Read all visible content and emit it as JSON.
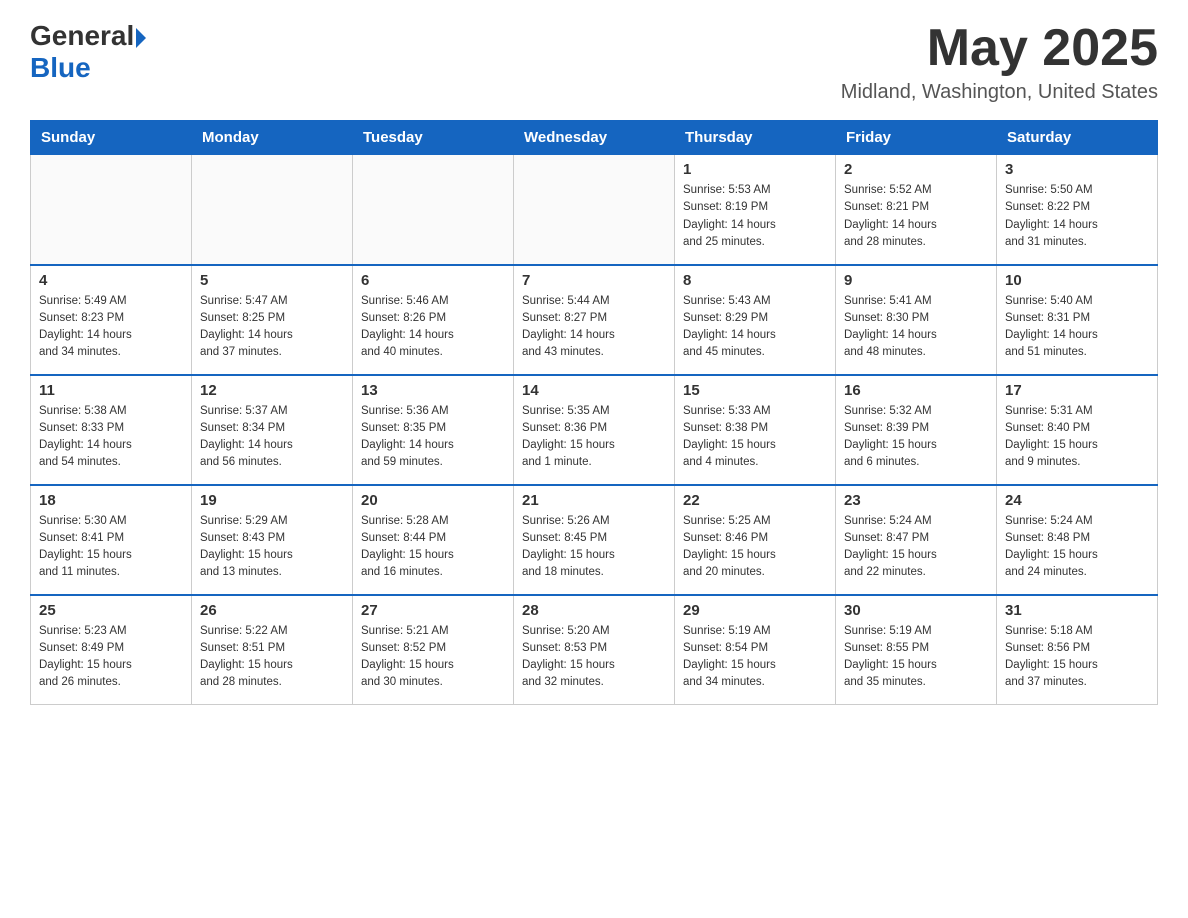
{
  "header": {
    "logo_general": "General",
    "logo_blue": "Blue",
    "month_title": "May 2025",
    "location": "Midland, Washington, United States"
  },
  "weekdays": [
    "Sunday",
    "Monday",
    "Tuesday",
    "Wednesday",
    "Thursday",
    "Friday",
    "Saturday"
  ],
  "weeks": [
    [
      {
        "day": "",
        "info": ""
      },
      {
        "day": "",
        "info": ""
      },
      {
        "day": "",
        "info": ""
      },
      {
        "day": "",
        "info": ""
      },
      {
        "day": "1",
        "info": "Sunrise: 5:53 AM\nSunset: 8:19 PM\nDaylight: 14 hours\nand 25 minutes."
      },
      {
        "day": "2",
        "info": "Sunrise: 5:52 AM\nSunset: 8:21 PM\nDaylight: 14 hours\nand 28 minutes."
      },
      {
        "day": "3",
        "info": "Sunrise: 5:50 AM\nSunset: 8:22 PM\nDaylight: 14 hours\nand 31 minutes."
      }
    ],
    [
      {
        "day": "4",
        "info": "Sunrise: 5:49 AM\nSunset: 8:23 PM\nDaylight: 14 hours\nand 34 minutes."
      },
      {
        "day": "5",
        "info": "Sunrise: 5:47 AM\nSunset: 8:25 PM\nDaylight: 14 hours\nand 37 minutes."
      },
      {
        "day": "6",
        "info": "Sunrise: 5:46 AM\nSunset: 8:26 PM\nDaylight: 14 hours\nand 40 minutes."
      },
      {
        "day": "7",
        "info": "Sunrise: 5:44 AM\nSunset: 8:27 PM\nDaylight: 14 hours\nand 43 minutes."
      },
      {
        "day": "8",
        "info": "Sunrise: 5:43 AM\nSunset: 8:29 PM\nDaylight: 14 hours\nand 45 minutes."
      },
      {
        "day": "9",
        "info": "Sunrise: 5:41 AM\nSunset: 8:30 PM\nDaylight: 14 hours\nand 48 minutes."
      },
      {
        "day": "10",
        "info": "Sunrise: 5:40 AM\nSunset: 8:31 PM\nDaylight: 14 hours\nand 51 minutes."
      }
    ],
    [
      {
        "day": "11",
        "info": "Sunrise: 5:38 AM\nSunset: 8:33 PM\nDaylight: 14 hours\nand 54 minutes."
      },
      {
        "day": "12",
        "info": "Sunrise: 5:37 AM\nSunset: 8:34 PM\nDaylight: 14 hours\nand 56 minutes."
      },
      {
        "day": "13",
        "info": "Sunrise: 5:36 AM\nSunset: 8:35 PM\nDaylight: 14 hours\nand 59 minutes."
      },
      {
        "day": "14",
        "info": "Sunrise: 5:35 AM\nSunset: 8:36 PM\nDaylight: 15 hours\nand 1 minute."
      },
      {
        "day": "15",
        "info": "Sunrise: 5:33 AM\nSunset: 8:38 PM\nDaylight: 15 hours\nand 4 minutes."
      },
      {
        "day": "16",
        "info": "Sunrise: 5:32 AM\nSunset: 8:39 PM\nDaylight: 15 hours\nand 6 minutes."
      },
      {
        "day": "17",
        "info": "Sunrise: 5:31 AM\nSunset: 8:40 PM\nDaylight: 15 hours\nand 9 minutes."
      }
    ],
    [
      {
        "day": "18",
        "info": "Sunrise: 5:30 AM\nSunset: 8:41 PM\nDaylight: 15 hours\nand 11 minutes."
      },
      {
        "day": "19",
        "info": "Sunrise: 5:29 AM\nSunset: 8:43 PM\nDaylight: 15 hours\nand 13 minutes."
      },
      {
        "day": "20",
        "info": "Sunrise: 5:28 AM\nSunset: 8:44 PM\nDaylight: 15 hours\nand 16 minutes."
      },
      {
        "day": "21",
        "info": "Sunrise: 5:26 AM\nSunset: 8:45 PM\nDaylight: 15 hours\nand 18 minutes."
      },
      {
        "day": "22",
        "info": "Sunrise: 5:25 AM\nSunset: 8:46 PM\nDaylight: 15 hours\nand 20 minutes."
      },
      {
        "day": "23",
        "info": "Sunrise: 5:24 AM\nSunset: 8:47 PM\nDaylight: 15 hours\nand 22 minutes."
      },
      {
        "day": "24",
        "info": "Sunrise: 5:24 AM\nSunset: 8:48 PM\nDaylight: 15 hours\nand 24 minutes."
      }
    ],
    [
      {
        "day": "25",
        "info": "Sunrise: 5:23 AM\nSunset: 8:49 PM\nDaylight: 15 hours\nand 26 minutes."
      },
      {
        "day": "26",
        "info": "Sunrise: 5:22 AM\nSunset: 8:51 PM\nDaylight: 15 hours\nand 28 minutes."
      },
      {
        "day": "27",
        "info": "Sunrise: 5:21 AM\nSunset: 8:52 PM\nDaylight: 15 hours\nand 30 minutes."
      },
      {
        "day": "28",
        "info": "Sunrise: 5:20 AM\nSunset: 8:53 PM\nDaylight: 15 hours\nand 32 minutes."
      },
      {
        "day": "29",
        "info": "Sunrise: 5:19 AM\nSunset: 8:54 PM\nDaylight: 15 hours\nand 34 minutes."
      },
      {
        "day": "30",
        "info": "Sunrise: 5:19 AM\nSunset: 8:55 PM\nDaylight: 15 hours\nand 35 minutes."
      },
      {
        "day": "31",
        "info": "Sunrise: 5:18 AM\nSunset: 8:56 PM\nDaylight: 15 hours\nand 37 minutes."
      }
    ]
  ]
}
